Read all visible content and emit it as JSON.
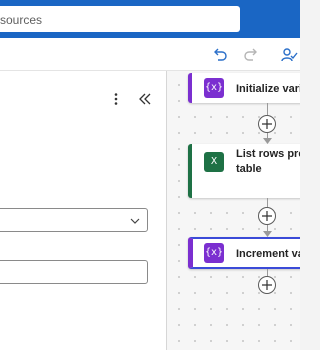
{
  "header": {
    "search_text": "sources"
  },
  "toolbar": {
    "undo_icon": "undo-icon",
    "redo_icon": "redo-icon",
    "checker_icon": "flow-checker-icon"
  },
  "panel": {
    "more_icon": "more-vertical-icon",
    "collapse_icon": "collapse-double-chevron-icon",
    "select_value": "",
    "field_value": ""
  },
  "flow": {
    "steps": [
      {
        "title": "Initialize varia",
        "title_line2": "",
        "icon": "variable-icon",
        "icon_glyph": "{x}",
        "accent": "#7b2fd0"
      },
      {
        "title": "List rows pres",
        "title_line2": "table",
        "icon": "excel-icon",
        "icon_glyph": "X",
        "accent": "#1e7145"
      },
      {
        "title": "Increment va",
        "title_line2": "",
        "icon": "variable-icon",
        "icon_glyph": "{x}",
        "accent": "#7b2fd0"
      }
    ],
    "selected_border": "#3b4bd8"
  }
}
